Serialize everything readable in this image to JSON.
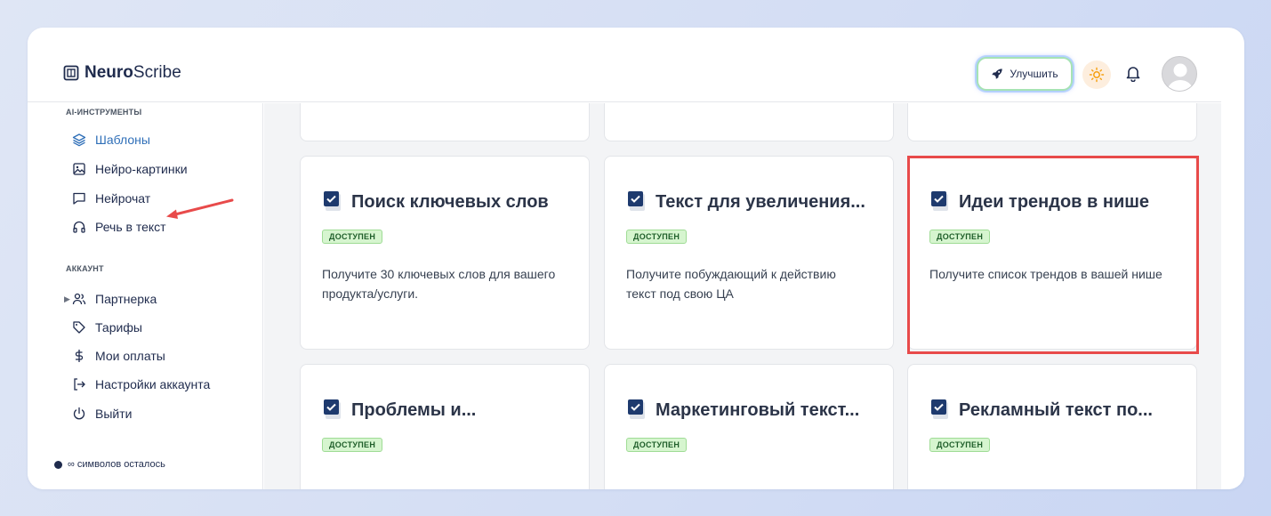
{
  "app": {
    "logo_bold": "Neuro",
    "logo_light": "Scribe",
    "upgrade_label": "Улучшить"
  },
  "sidebar": {
    "ai_section_label": "AI-ИНСТРУМЕНТЫ",
    "ai_items": [
      {
        "label": "Шаблоны",
        "icon": "layers-icon",
        "active": true
      },
      {
        "label": "Нейро-картинки",
        "icon": "image-icon"
      },
      {
        "label": "Нейрочат",
        "icon": "chat-icon"
      },
      {
        "label": "Речь в текст",
        "icon": "headphones-icon"
      }
    ],
    "account_section_label": "АККАУНТ",
    "account_items": [
      {
        "label": "Партнерка",
        "icon": "users-icon"
      },
      {
        "label": "Тарифы",
        "icon": "tag-icon"
      },
      {
        "label": "Мои оплаты",
        "icon": "dollar-icon"
      },
      {
        "label": "Настройки аккаунта",
        "icon": "login-icon"
      },
      {
        "label": "Выйти",
        "icon": "power-icon"
      }
    ],
    "symbols_note": "∞ символов осталось"
  },
  "cards": [
    {
      "title": "Поиск ключевых слов",
      "badge": "ДОСТУПЕН",
      "desc": "Получите 30 ключевых слов для вашего продукта/услуги."
    },
    {
      "title": "Текст для увеличения...",
      "badge": "ДОСТУПЕН",
      "desc": "Получите побуждающий к действию текст под свою ЦА"
    },
    {
      "title": "Идеи трендов в нише",
      "badge": "ДОСТУПЕН",
      "desc": "Получите список трендов в вашей нише"
    },
    {
      "title": "Проблемы и...",
      "badge": "ДОСТУПЕН",
      "desc": ""
    },
    {
      "title": "Маркетинговый текст...",
      "badge": "ДОСТУПЕН",
      "desc": ""
    },
    {
      "title": "Рекламный текст по...",
      "badge": "ДОСТУПЕН",
      "desc": ""
    }
  ],
  "colors": {
    "accent": "#2f6fb8",
    "highlight_red": "#e84a4a",
    "badge_green": "#d6f5cf"
  }
}
